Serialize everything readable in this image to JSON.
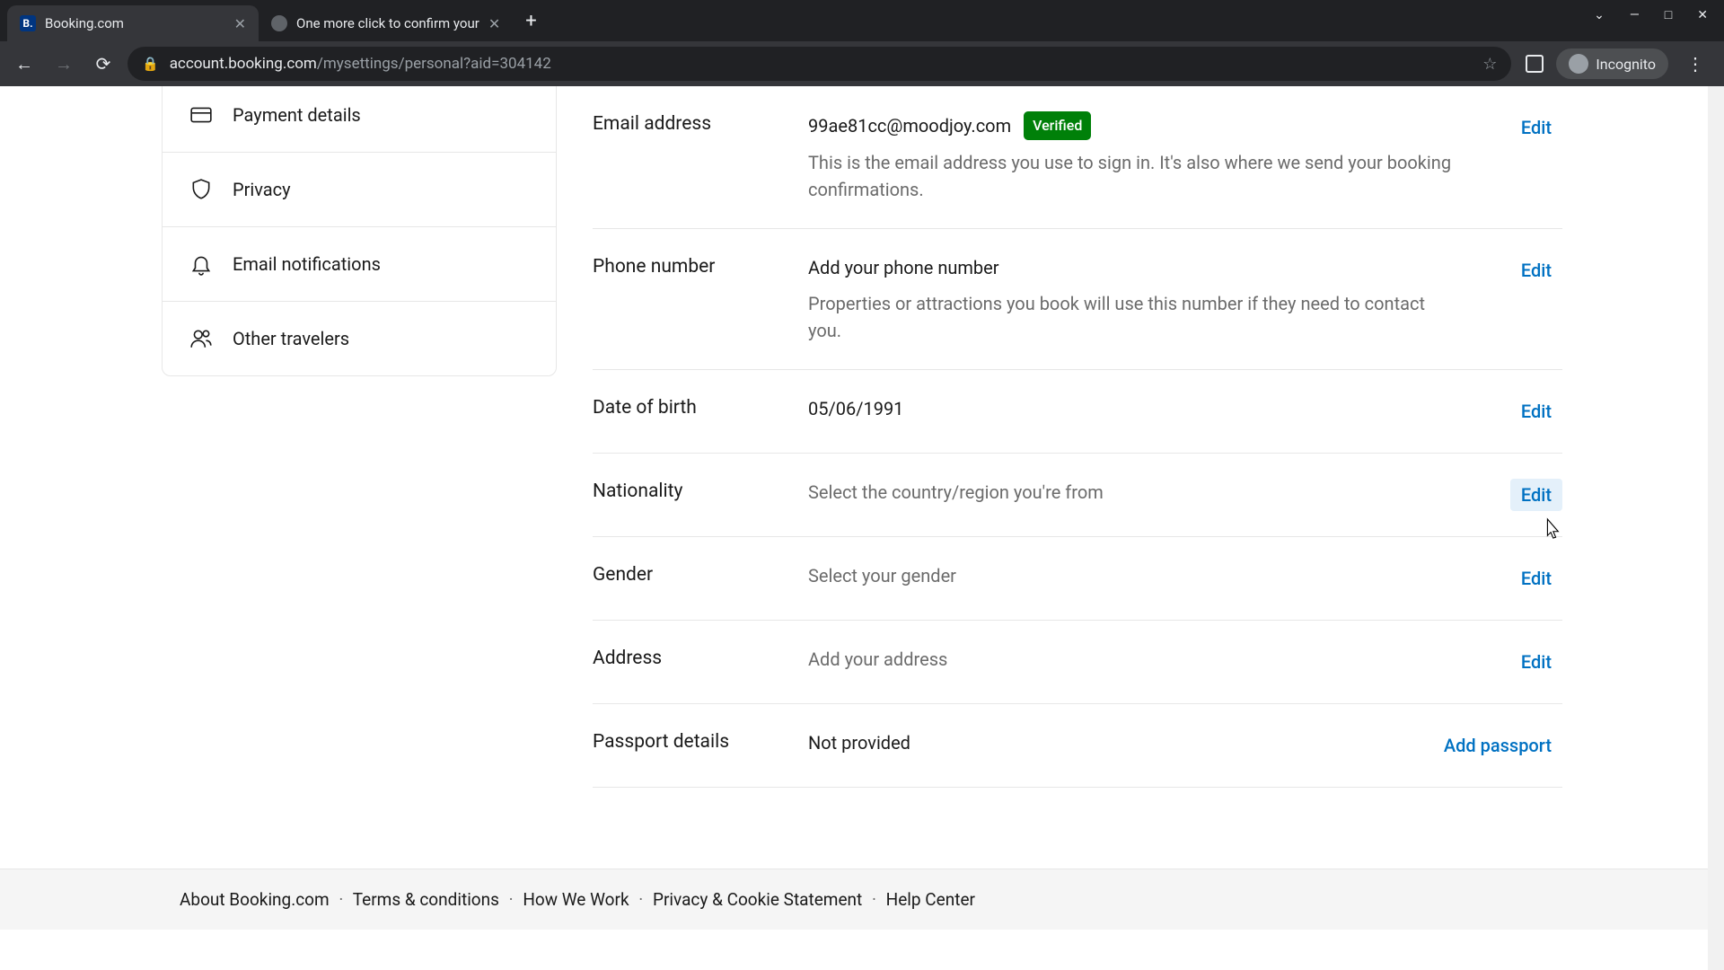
{
  "browser": {
    "tabs": [
      {
        "title": "Booking.com",
        "favicon_letter": "B.",
        "active": true
      },
      {
        "title": "One more click to confirm your",
        "favicon_letter": "",
        "active": false
      }
    ],
    "url_host": "account.booking.com",
    "url_path": "/mysettings/personal?aid=304142",
    "incognito_label": "Incognito"
  },
  "sidebar": {
    "items": [
      {
        "label": "Payment details"
      },
      {
        "label": "Privacy"
      },
      {
        "label": "Email notifications"
      },
      {
        "label": "Other travelers"
      }
    ]
  },
  "rows": {
    "email": {
      "label": "Email address",
      "value": "99ae81cc@moodjoy.com",
      "badge": "Verified",
      "desc": "This is the email address you use to sign in. It's also where we send your booking confirmations.",
      "action": "Edit"
    },
    "phone": {
      "label": "Phone number",
      "value": "Add your phone number",
      "desc": "Properties or attractions you book will use this number if they need to contact you.",
      "action": "Edit"
    },
    "dob": {
      "label": "Date of birth",
      "value": "05/06/1991",
      "action": "Edit"
    },
    "nationality": {
      "label": "Nationality",
      "value": "Select the country/region you're from",
      "action": "Edit"
    },
    "gender": {
      "label": "Gender",
      "value": "Select your gender",
      "action": "Edit"
    },
    "address": {
      "label": "Address",
      "value": "Add your address",
      "action": "Edit"
    },
    "passport": {
      "label": "Passport details",
      "value": "Not provided",
      "action": "Add passport"
    }
  },
  "footer": {
    "links": [
      "About Booking.com",
      "Terms & conditions",
      "How We Work",
      "Privacy & Cookie Statement",
      "Help Center"
    ]
  }
}
